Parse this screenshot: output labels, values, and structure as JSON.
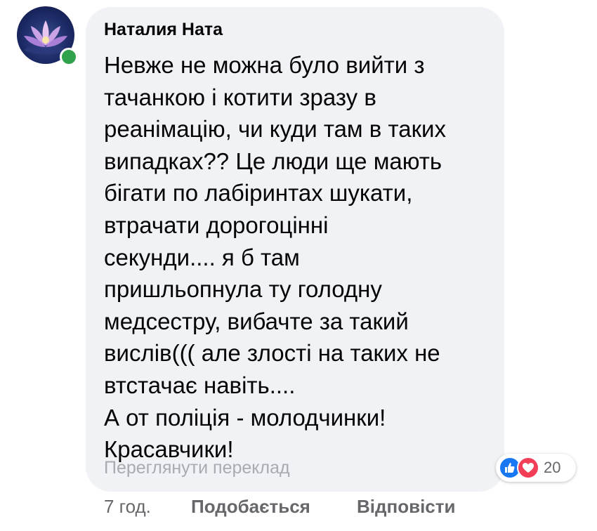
{
  "comment": {
    "author": "Наталия Ната",
    "lines": [
      "Невже не можна було вийти з",
      "тачанкою і котити зразу в",
      "реанімацію, чи куди там в таких",
      "випадках?? Це люди ще мають",
      "бігати по лабіринтах шукати,",
      "втрачати дорогоцінні",
      "секунди.... я б там",
      "пришльопнула ту голодну",
      "медсестру, вибачте за такий",
      "вислів((( але злості на таких не",
      "втстачає навіть....",
      "А от поліція - молодчинки!",
      "Красавчики!"
    ],
    "translate_label": "Переглянути переклад",
    "reactions": {
      "count": "20",
      "icons": [
        "like-icon",
        "love-icon"
      ],
      "like_color": "#1877f2",
      "love_color": "#f33e58"
    },
    "actions": {
      "time": "7 год.",
      "like_label": "Подобається",
      "reply_label": "Відповісти"
    },
    "avatar": {
      "icon": "lotus-flower-avatar",
      "online_color": "#31a24c"
    }
  }
}
